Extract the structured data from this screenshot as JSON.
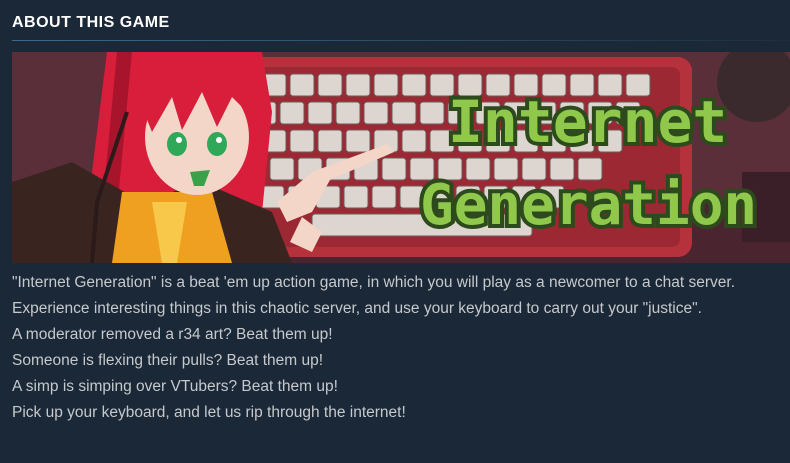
{
  "section": {
    "heading": "ABOUT THIS GAME"
  },
  "banner": {
    "title_line1": "Internet",
    "title_line2": "Generation",
    "colors": {
      "background": "#5a2f3a",
      "keyboard_body": "#b5313b",
      "title_green": "#8fc84a",
      "title_outline": "#2d4a1c",
      "hair_red": "#d81e3a"
    }
  },
  "description": {
    "intro": "\"Internet Generation\" is a beat 'em up action game, in which you will play as a newcomer to a chat server. Experience interesting things in this chaotic server, and use your keyboard to carry out your \"justice\".",
    "line1": "A moderator removed a r34 art? Beat them up!",
    "line2": "Someone is flexing their pulls? Beat them up!",
    "line3": "A simp is simping over VTubers? Beat them up!",
    "line4": "Pick up your keyboard, and let us rip through the internet!"
  }
}
